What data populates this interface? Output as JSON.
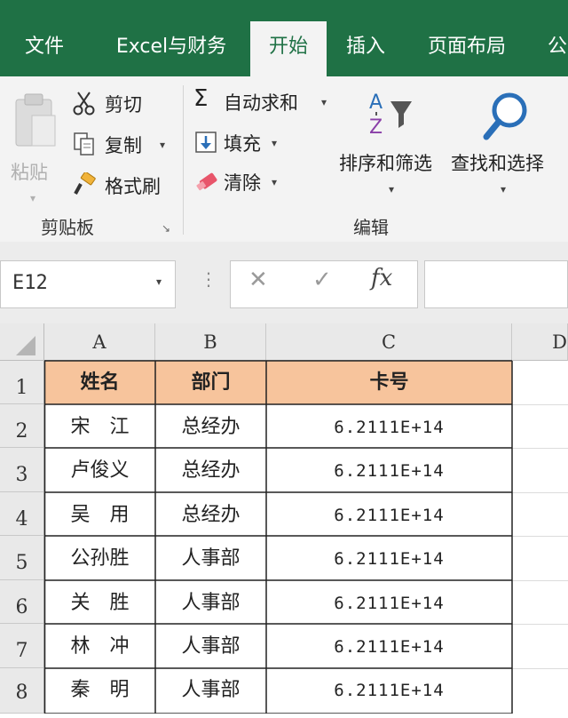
{
  "tabs": [
    {
      "label": "文件"
    },
    {
      "label": "Excel与财务"
    },
    {
      "label": "开始"
    },
    {
      "label": "插入"
    },
    {
      "label": "页面布局"
    },
    {
      "label": "公"
    }
  ],
  "ribbon": {
    "clipboard": {
      "paste_label": "粘贴",
      "cut_label": "剪切",
      "copy_label": "复制",
      "format_painter_label": "格式刷",
      "group_label": "剪贴板"
    },
    "editing": {
      "autosum_label": "自动求和",
      "fill_label": "填充",
      "clear_label": "清除",
      "sort_filter_label": "排序和筛选",
      "find_select_label": "查找和选择",
      "group_label": "编辑"
    }
  },
  "formula_bar": {
    "name_box": "E12",
    "fx_label": "fx",
    "formula": ""
  },
  "grid": {
    "columns": [
      "A",
      "B",
      "C",
      "D"
    ],
    "rows": [
      "1",
      "2",
      "3",
      "4",
      "5",
      "6",
      "7",
      "8"
    ],
    "header": [
      "姓名",
      "部门",
      "卡号"
    ],
    "data": [
      [
        "宋　江",
        "总经办",
        "6.2111E+14"
      ],
      [
        "卢俊义",
        "总经办",
        "6.2111E+14"
      ],
      [
        "吴　用",
        "总经办",
        "6.2111E+14"
      ],
      [
        "公孙胜",
        "人事部",
        "6.2111E+14"
      ],
      [
        "关　胜",
        "人事部",
        "6.2111E+14"
      ],
      [
        "林　冲",
        "人事部",
        "6.2111E+14"
      ],
      [
        "秦　明",
        "人事部",
        "6.2111E+14"
      ]
    ]
  },
  "colors": {
    "excel_green": "#1f7145",
    "header_fill": "#f7c49c"
  }
}
